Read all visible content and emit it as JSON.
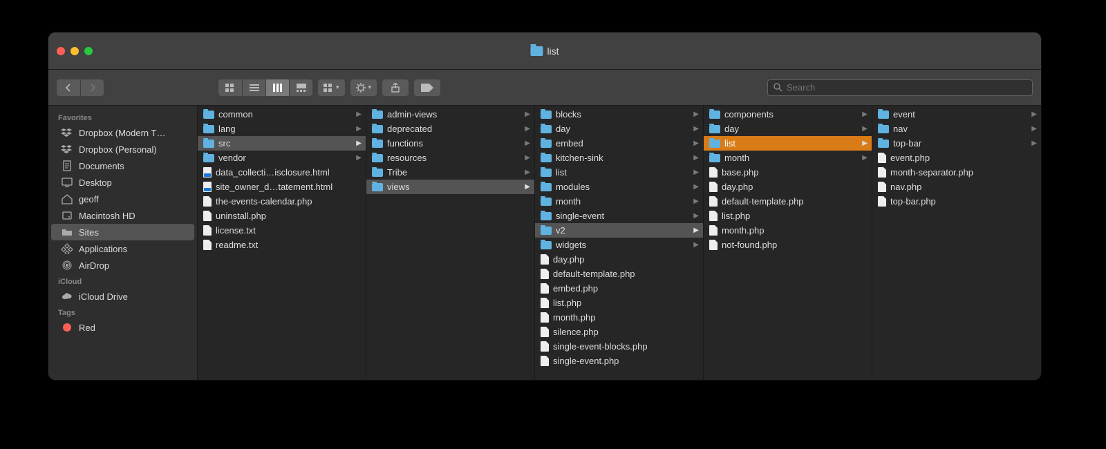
{
  "window": {
    "title": "list"
  },
  "search": {
    "placeholder": "Search"
  },
  "sidebar": {
    "sections": [
      {
        "header": "Favorites",
        "items": [
          {
            "label": "Dropbox (Modern T…",
            "icon": "dropbox"
          },
          {
            "label": "Dropbox (Personal)",
            "icon": "dropbox"
          },
          {
            "label": "Documents",
            "icon": "doc"
          },
          {
            "label": "Desktop",
            "icon": "desktop"
          },
          {
            "label": "geoff",
            "icon": "home"
          },
          {
            "label": "Macintosh HD",
            "icon": "disk"
          },
          {
            "label": "Sites",
            "icon": "folder",
            "selected": true
          },
          {
            "label": "Applications",
            "icon": "apps"
          },
          {
            "label": "AirDrop",
            "icon": "airdrop"
          }
        ]
      },
      {
        "header": "iCloud",
        "items": [
          {
            "label": "iCloud Drive",
            "icon": "cloud"
          }
        ]
      },
      {
        "header": "Tags",
        "items": [
          {
            "label": "Red",
            "icon": "tag",
            "color": "#ff5f57"
          }
        ]
      }
    ]
  },
  "columns": [
    [
      {
        "name": "common",
        "type": "folder",
        "expandable": true
      },
      {
        "name": "lang",
        "type": "folder",
        "expandable": true
      },
      {
        "name": "src",
        "type": "folder",
        "expandable": true,
        "selected": true
      },
      {
        "name": "vendor",
        "type": "folder",
        "expandable": true
      },
      {
        "name": "data_collecti…isclosure.html",
        "type": "html"
      },
      {
        "name": "site_owner_d…tatement.html",
        "type": "html"
      },
      {
        "name": "the-events-calendar.php",
        "type": "file"
      },
      {
        "name": "uninstall.php",
        "type": "file"
      },
      {
        "name": "license.txt",
        "type": "file"
      },
      {
        "name": "readme.txt",
        "type": "file"
      }
    ],
    [
      {
        "name": "admin-views",
        "type": "folder",
        "expandable": true
      },
      {
        "name": "deprecated",
        "type": "folder",
        "expandable": true
      },
      {
        "name": "functions",
        "type": "folder",
        "expandable": true
      },
      {
        "name": "resources",
        "type": "folder",
        "expandable": true
      },
      {
        "name": "Tribe",
        "type": "folder",
        "expandable": true
      },
      {
        "name": "views",
        "type": "folder",
        "expandable": true,
        "selected": true
      }
    ],
    [
      {
        "name": "blocks",
        "type": "folder",
        "expandable": true
      },
      {
        "name": "day",
        "type": "folder",
        "expandable": true
      },
      {
        "name": "embed",
        "type": "folder",
        "expandable": true
      },
      {
        "name": "kitchen-sink",
        "type": "folder",
        "expandable": true
      },
      {
        "name": "list",
        "type": "folder",
        "expandable": true
      },
      {
        "name": "modules",
        "type": "folder",
        "expandable": true
      },
      {
        "name": "month",
        "type": "folder",
        "expandable": true
      },
      {
        "name": "single-event",
        "type": "folder",
        "expandable": true
      },
      {
        "name": "v2",
        "type": "folder",
        "expandable": true,
        "selected": true
      },
      {
        "name": "widgets",
        "type": "folder",
        "expandable": true
      },
      {
        "name": "day.php",
        "type": "file"
      },
      {
        "name": "default-template.php",
        "type": "file"
      },
      {
        "name": "embed.php",
        "type": "file"
      },
      {
        "name": "list.php",
        "type": "file"
      },
      {
        "name": "month.php",
        "type": "file"
      },
      {
        "name": "silence.php",
        "type": "file"
      },
      {
        "name": "single-event-blocks.php",
        "type": "file"
      },
      {
        "name": "single-event.php",
        "type": "file"
      }
    ],
    [
      {
        "name": "components",
        "type": "folder",
        "expandable": true
      },
      {
        "name": "day",
        "type": "folder",
        "expandable": true
      },
      {
        "name": "list",
        "type": "folder",
        "expandable": true,
        "highlighted": true
      },
      {
        "name": "month",
        "type": "folder",
        "expandable": true
      },
      {
        "name": "base.php",
        "type": "file"
      },
      {
        "name": "day.php",
        "type": "file"
      },
      {
        "name": "default-template.php",
        "type": "file"
      },
      {
        "name": "list.php",
        "type": "file"
      },
      {
        "name": "month.php",
        "type": "file"
      },
      {
        "name": "not-found.php",
        "type": "file"
      }
    ],
    [
      {
        "name": "event",
        "type": "folder",
        "expandable": true
      },
      {
        "name": "nav",
        "type": "folder",
        "expandable": true
      },
      {
        "name": "top-bar",
        "type": "folder",
        "expandable": true
      },
      {
        "name": "event.php",
        "type": "file"
      },
      {
        "name": "month-separator.php",
        "type": "file"
      },
      {
        "name": "nav.php",
        "type": "file"
      },
      {
        "name": "top-bar.php",
        "type": "file"
      }
    ]
  ]
}
